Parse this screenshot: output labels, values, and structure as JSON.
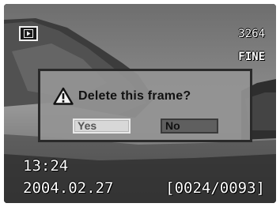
{
  "screen": {
    "mode_icon": "playback-icon",
    "frame_count": "3264",
    "quality": "FINE",
    "time": "13:24",
    "date": "2004.02.27",
    "frame_index": "[0024/0093]"
  },
  "dialog": {
    "icon": "warning-icon",
    "title": "Delete this frame?",
    "yes_label": "Yes",
    "no_label": "No"
  }
}
